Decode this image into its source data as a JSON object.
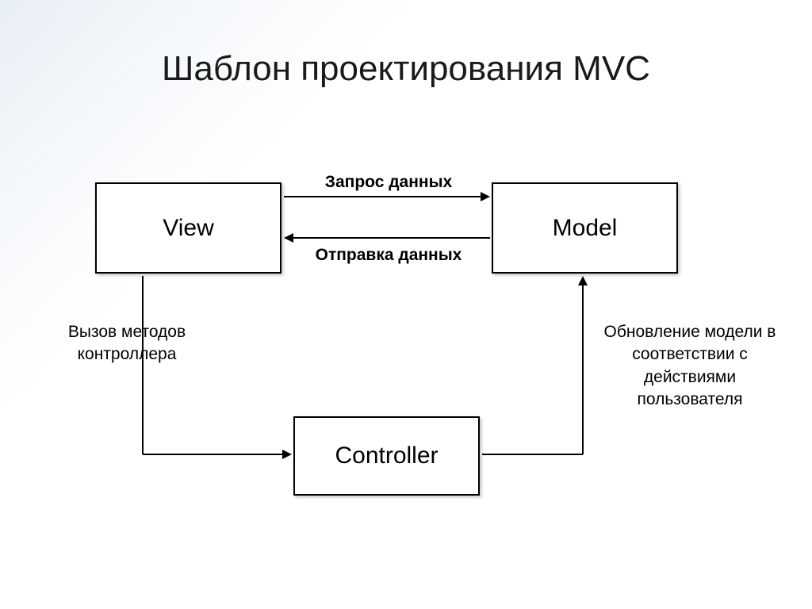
{
  "title": "Шаблон проектирования MVC",
  "boxes": {
    "view": "View",
    "model": "Model",
    "controller": "Controller"
  },
  "arrows": {
    "request": "Запрос данных",
    "response": "Отправка данных",
    "call": "Вызов методов контроллера",
    "update": "Обновление модели в соответствии с действиями пользователя"
  }
}
